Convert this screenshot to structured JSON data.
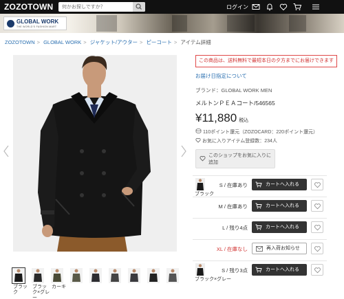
{
  "header": {
    "logo": "ZOZOTOWN",
    "search_placeholder": "何かお探しですか？",
    "login": "ログイン"
  },
  "banner": {
    "brand_name": "GLOBAL WORK",
    "brand_tagline": "THE WORLD'S FASHION MART"
  },
  "breadcrumb": {
    "items": [
      "ZOZOTOWN",
      "GLOBAL WORK",
      "ジャケット/アウター",
      "ピーコート"
    ],
    "current": "アイテム詳細"
  },
  "thumbnails": [
    {
      "label": "ブラック",
      "color": "#1a1a1a",
      "selected": true
    },
    {
      "label": "ブラック×グレー",
      "color": "#2a2a2a",
      "selected": false
    },
    {
      "label": "カーキ",
      "color": "#4a4a36",
      "selected": false
    },
    {
      "label": "",
      "color": "#5a5a48",
      "selected": false
    },
    {
      "label": "",
      "color": "#2c2c30",
      "selected": false
    },
    {
      "label": "",
      "color": "#444",
      "selected": false
    },
    {
      "label": "",
      "color": "#3a3a3e",
      "selected": false
    },
    {
      "label": "",
      "color": "#222",
      "selected": false
    },
    {
      "label": "",
      "color": "#555",
      "selected": false
    }
  ],
  "product": {
    "notice": "この商品は、送料無料で最短本日の夕方までにお届けできます",
    "delivery_link": "お届け日指定について",
    "brand": "ブランド：GLOBAL WORK MEN",
    "name": "メルトンＰＥＡコート/546565",
    "price": "¥11,880",
    "tax_label": "税込",
    "points": "110ポイント還元（ZOZOCARD：220ポイント還元）",
    "favorites": "お気に入りアイテム登録数：234人",
    "shop_favorite": "このショップをお気に入りに追加"
  },
  "skus": [
    {
      "label": "S / 在庫あり",
      "action": "カートへ入れる",
      "type": "cart",
      "color_label": "ブラック",
      "red": false
    },
    {
      "label": "M / 在庫あり",
      "action": "カートへ入れる",
      "type": "cart",
      "color_label": "",
      "red": false
    },
    {
      "label": "L / 残り4点",
      "action": "カートへ入れる",
      "type": "cart",
      "color_label": "",
      "red": false
    },
    {
      "label": "XL / 在庫なし",
      "action": "再入荷お知らせ",
      "type": "notify",
      "color_label": "",
      "red": true
    },
    {
      "label": "S / 残り3点",
      "action": "カートへ入れる",
      "type": "cart",
      "color_label": "ブラック×グレー",
      "red": false
    }
  ],
  "colors": {
    "header_bg": "#111111",
    "link": "#2a6fb0",
    "notice_red": "#d0302f",
    "cart_btn": "#333333"
  }
}
